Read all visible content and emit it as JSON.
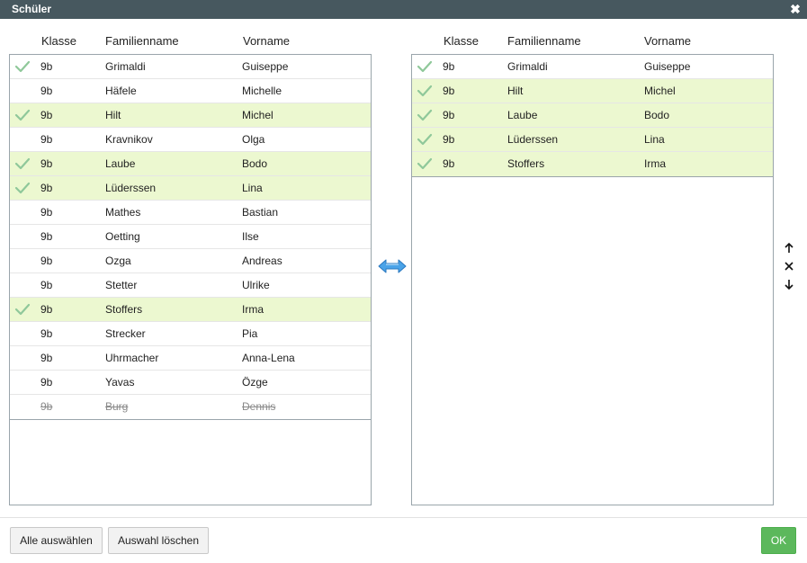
{
  "dialog": {
    "title": "Schüler"
  },
  "columns": {
    "klasse": "Klasse",
    "familienname": "Familienname",
    "vorname": "Vorname"
  },
  "left_list": [
    {
      "klasse": "9b",
      "familienname": "Grimaldi",
      "vorname": "Guiseppe",
      "checked": true,
      "highlighted": false,
      "deleted": false
    },
    {
      "klasse": "9b",
      "familienname": "Häfele",
      "vorname": "Michelle",
      "checked": false,
      "highlighted": false,
      "deleted": false
    },
    {
      "klasse": "9b",
      "familienname": "Hilt",
      "vorname": "Michel",
      "checked": true,
      "highlighted": true,
      "deleted": false
    },
    {
      "klasse": "9b",
      "familienname": "Kravnikov",
      "vorname": "Olga",
      "checked": false,
      "highlighted": false,
      "deleted": false
    },
    {
      "klasse": "9b",
      "familienname": "Laube",
      "vorname": "Bodo",
      "checked": true,
      "highlighted": true,
      "deleted": false
    },
    {
      "klasse": "9b",
      "familienname": "Lüderssen",
      "vorname": "Lina",
      "checked": true,
      "highlighted": true,
      "deleted": false
    },
    {
      "klasse": "9b",
      "familienname": "Mathes",
      "vorname": "Bastian",
      "checked": false,
      "highlighted": false,
      "deleted": false
    },
    {
      "klasse": "9b",
      "familienname": "Oetting",
      "vorname": "Ilse",
      "checked": false,
      "highlighted": false,
      "deleted": false
    },
    {
      "klasse": "9b",
      "familienname": "Ozga",
      "vorname": "Andreas",
      "checked": false,
      "highlighted": false,
      "deleted": false
    },
    {
      "klasse": "9b",
      "familienname": "Stetter",
      "vorname": "Ulrike",
      "checked": false,
      "highlighted": false,
      "deleted": false
    },
    {
      "klasse": "9b",
      "familienname": "Stoffers",
      "vorname": "Irma",
      "checked": true,
      "highlighted": true,
      "deleted": false
    },
    {
      "klasse": "9b",
      "familienname": "Strecker",
      "vorname": "Pia",
      "checked": false,
      "highlighted": false,
      "deleted": false
    },
    {
      "klasse": "9b",
      "familienname": "Uhrmacher",
      "vorname": "Anna-Lena",
      "checked": false,
      "highlighted": false,
      "deleted": false
    },
    {
      "klasse": "9b",
      "familienname": "Yavas",
      "vorname": "Özge",
      "checked": false,
      "highlighted": false,
      "deleted": false
    },
    {
      "klasse": "9b",
      "familienname": "Burg",
      "vorname": "Dennis",
      "checked": false,
      "highlighted": false,
      "deleted": true
    }
  ],
  "right_list": [
    {
      "klasse": "9b",
      "familienname": "Grimaldi",
      "vorname": "Guiseppe",
      "checked": true,
      "highlighted": false,
      "deleted": false
    },
    {
      "klasse": "9b",
      "familienname": "Hilt",
      "vorname": "Michel",
      "checked": true,
      "highlighted": true,
      "deleted": false
    },
    {
      "klasse": "9b",
      "familienname": "Laube",
      "vorname": "Bodo",
      "checked": true,
      "highlighted": true,
      "deleted": false
    },
    {
      "klasse": "9b",
      "familienname": "Lüderssen",
      "vorname": "Lina",
      "checked": true,
      "highlighted": true,
      "deleted": false
    },
    {
      "klasse": "9b",
      "familienname": "Stoffers",
      "vorname": "Irma",
      "checked": true,
      "highlighted": true,
      "deleted": false
    }
  ],
  "footer": {
    "select_all": "Alle auswählen",
    "clear_selection": "Auswahl löschen",
    "ok": "OK"
  },
  "icons": {
    "close": "close-icon",
    "swap": "swap-arrows-icon",
    "up": "arrow-up-icon",
    "remove": "remove-icon",
    "down": "arrow-down-icon",
    "check": "check-icon"
  },
  "colors": {
    "titlebar": "#47585f",
    "selected_row": "#ecf8d0",
    "check": "#8fc89a",
    "ok_button": "#5cb85c",
    "swap_arrow": "#3a8fd6"
  }
}
